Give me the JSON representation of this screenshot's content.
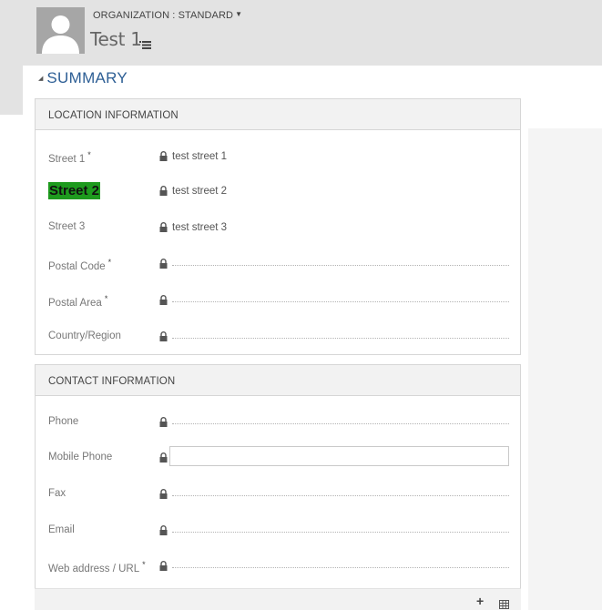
{
  "header": {
    "entity_type": "ORGANIZATION : STANDARD",
    "record_title": "Test 1"
  },
  "summary": {
    "label": "SUMMARY"
  },
  "location_section": {
    "title": "LOCATION INFORMATION",
    "fields": [
      {
        "label": "Street 1",
        "required": "*",
        "value": "test street 1"
      },
      {
        "label": "Street 2",
        "value": "test street 2"
      },
      {
        "label": "Street 3",
        "value": "test street 3"
      },
      {
        "label": "Postal Code",
        "required": "*",
        "value": ""
      },
      {
        "label": "Postal Area",
        "required": "*",
        "value": ""
      },
      {
        "label": "Country/Region",
        "value": ""
      }
    ]
  },
  "contact_section": {
    "title": "CONTACT INFORMATION",
    "fields": [
      {
        "label": "Phone",
        "value": ""
      },
      {
        "label": "Mobile Phone",
        "value": ""
      },
      {
        "label": "Fax",
        "value": ""
      },
      {
        "label": "Email",
        "value": ""
      },
      {
        "label": "Web address / URL",
        "required": "*",
        "value": ""
      }
    ]
  },
  "colors": {
    "accent_blue": "#2e5f95",
    "highlight_green": "#1e9a1e"
  },
  "icons": {
    "avatar": "person-silhouette-icon",
    "lock": "lock-icon",
    "menu": "list-menu-icon",
    "add": "plus-icon",
    "grid": "grid-icon"
  }
}
